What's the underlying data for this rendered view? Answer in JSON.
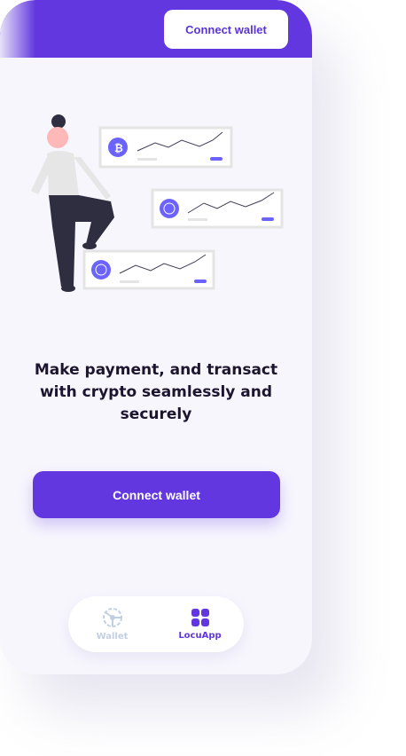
{
  "header": {
    "connect_label": "Connect wallet"
  },
  "hero": {
    "title": "Make payment, and transact with crypto seamlessly and securely"
  },
  "main": {
    "connect_label": "Connect wallet"
  },
  "nav": {
    "items": [
      {
        "label": "Wallet",
        "icon": "network-icon"
      },
      {
        "label": "LocuApp",
        "icon": "grid-icon"
      }
    ]
  },
  "colors": {
    "accent": "#6237df",
    "inactive": "#c2cfe3"
  }
}
